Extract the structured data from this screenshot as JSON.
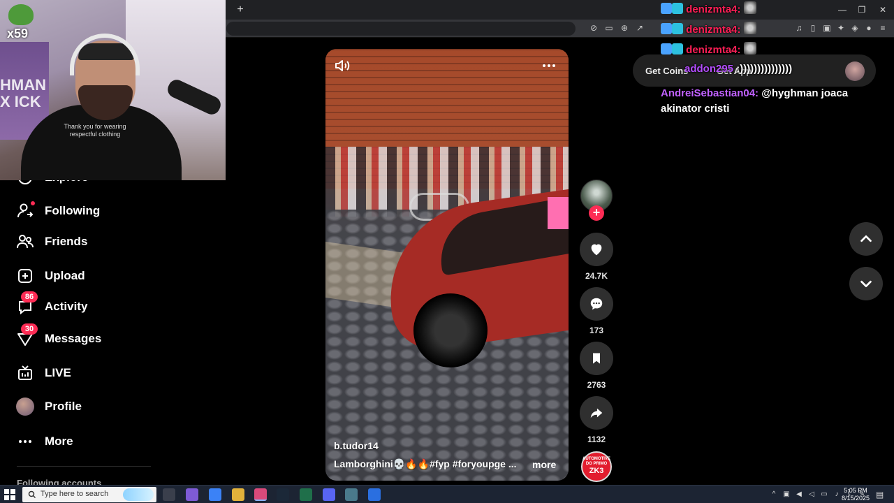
{
  "browser": {
    "new_tab": "+",
    "window_controls": {
      "minimize": "—",
      "maximize": "❐",
      "close": "✕"
    }
  },
  "webcam": {
    "badge": "x59",
    "poster_text": "HMAN X ICK",
    "shirt_text": "Thank you for wearing respectful clothing"
  },
  "sidebar": {
    "items": [
      {
        "label": "Explore"
      },
      {
        "label": "Following"
      },
      {
        "label": "Friends"
      },
      {
        "label": "Upload"
      },
      {
        "label": "Activity",
        "badge": "86"
      },
      {
        "label": "Messages",
        "badge": "30"
      },
      {
        "label": "LIVE"
      },
      {
        "label": "Profile"
      },
      {
        "label": "More"
      }
    ],
    "following_accounts": "Following accounts"
  },
  "video": {
    "username": "b.tudor14",
    "caption": "Lamborghini💀🔥🔥#fyp #foryoupge ...",
    "more_label": "more"
  },
  "actions": {
    "likes": "24.7K",
    "comments": "173",
    "saves": "2763",
    "shares": "1132",
    "music_disc": {
      "line1": "AUTOMOTIVE DO PRIMO",
      "line2": "ZK3"
    }
  },
  "top_bar": {
    "get_coins": "Get Coins",
    "get_app": "Get App"
  },
  "chat": [
    {
      "user": "denizmta4:",
      "message": ""
    },
    {
      "user": "denizmta4:",
      "message": ""
    },
    {
      "user": "denizmta4:",
      "message": ""
    },
    {
      "user": "addon295",
      "message": ":)))))))))))))))"
    },
    {
      "user": "AndreiSebastian04:",
      "message": "@hyghman joaca akinator cristi"
    }
  ],
  "taskbar": {
    "search_placeholder": "Type here to search",
    "time": "5:05 PM",
    "date": "8/15/2025"
  },
  "colors": {
    "accent": "#fe2c55",
    "chat_red": "#ff1f56",
    "chat_purple": "#b44dff",
    "action_bg": "#2f2f2f"
  }
}
